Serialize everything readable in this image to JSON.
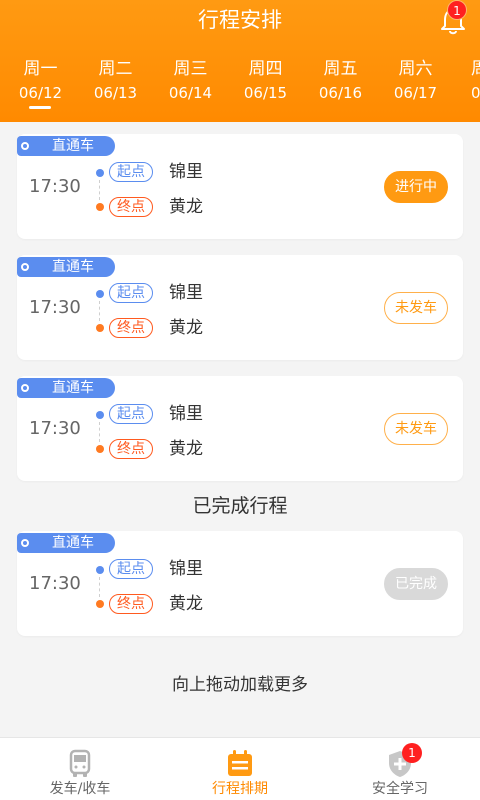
{
  "header": {
    "title": "行程安排",
    "notification_count": "1"
  },
  "week": [
    {
      "weekday": "周一",
      "date": "06/12",
      "selected": true
    },
    {
      "weekday": "周二",
      "date": "06/13"
    },
    {
      "weekday": "周三",
      "date": "06/14"
    },
    {
      "weekday": "周四",
      "date": "06/15"
    },
    {
      "weekday": "周五",
      "date": "06/16"
    },
    {
      "weekday": "周六",
      "date": "06/17"
    },
    {
      "weekday": "周",
      "date": "0"
    }
  ],
  "trips": [
    {
      "tag": "直通车",
      "time": "17:30",
      "start_label": "起点",
      "start": "锦里",
      "end_label": "终点",
      "end": "黄龙",
      "status": "进行中"
    },
    {
      "tag": "直通车",
      "time": "17:30",
      "start_label": "起点",
      "start": "锦里",
      "end_label": "终点",
      "end": "黄龙",
      "status": "未发车"
    },
    {
      "tag": "直通车",
      "time": "17:30",
      "start_label": "起点",
      "start": "锦里",
      "end_label": "终点",
      "end": "黄龙",
      "status": "未发车"
    }
  ],
  "completed": {
    "title": "已完成行程",
    "trips": [
      {
        "tag": "直通车",
        "time": "17:30",
        "start_label": "起点",
        "start": "锦里",
        "end_label": "终点",
        "end": "黄龙",
        "status": "已完成"
      }
    ]
  },
  "load_more": "向上拖动加载更多",
  "tabbar": {
    "tabs": [
      {
        "label": "发车/收车",
        "icon": "bus-icon"
      },
      {
        "label": "行程排期",
        "icon": "calendar-icon",
        "active": true
      },
      {
        "label": "安全学习",
        "icon": "shield-plus-icon",
        "badge": "1"
      }
    ]
  },
  "colors": {
    "brand_orange": "#ff8a00",
    "tag_blue": "#5b8def",
    "end_orange": "#ff5a1f",
    "inactive_gray": "#d9d9d9"
  }
}
